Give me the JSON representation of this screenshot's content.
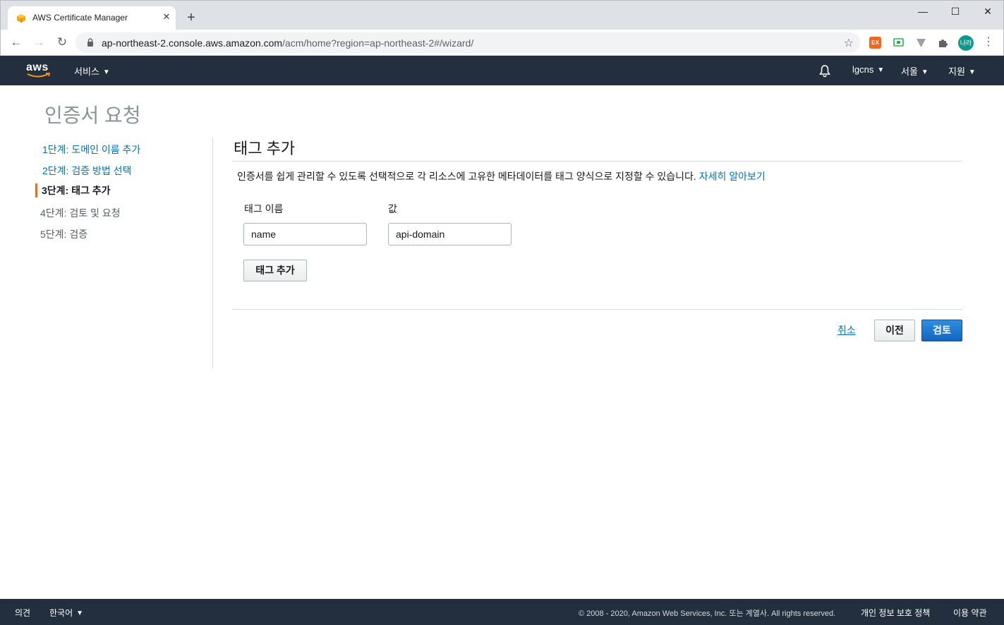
{
  "browser": {
    "tab_title": "AWS Certificate Manager",
    "tab_close": "✕",
    "new_tab": "+",
    "url_host": "ap-northeast-2.console.aws.amazon.com",
    "url_path": "/acm/home?region=ap-northeast-2#/wizard/",
    "back": "←",
    "forward": "→",
    "reload": "↻",
    "star": "☆",
    "minimize": "—",
    "maximize": "☐",
    "close": "✕",
    "ext1_label": "EX",
    "profile_label": "나라",
    "menu": "⋮"
  },
  "aws_header": {
    "logo": "aws",
    "services": "서비스",
    "account": "lgcns",
    "region": "서울",
    "support": "지원"
  },
  "page": {
    "title": "인증서 요청"
  },
  "steps": [
    {
      "label": "1단계: 도메인 이름 추가"
    },
    {
      "label": "2단계: 검증 방법 선택"
    },
    {
      "label": "3단계: 태그 추가"
    },
    {
      "label": "4단계: 검토 및 요청"
    },
    {
      "label": "5단계: 검증"
    }
  ],
  "section": {
    "title": "태그 추가",
    "description": "인증서를 쉽게 관리할 수 있도록 선택적으로 각 리소스에 고유한 메타데이터를 태그 양식으로 지정할 수 있습니다. ",
    "learn_more": "자세히 알아보기"
  },
  "tag_form": {
    "name_label": "태그 이름",
    "value_label": "값",
    "name_value": "name",
    "value_value": "api-domain",
    "add_button": "태그 추가"
  },
  "actions": {
    "cancel": "취소",
    "previous": "이전",
    "review": "검토"
  },
  "footer": {
    "feedback": "의견",
    "language": "한국어",
    "copyright": "© 2008 - 2020, Amazon Web Services, Inc. 또는 계열사. All rights reserved.",
    "privacy": "개인 정보 보호 정책",
    "terms": "이용 약관"
  },
  "colors": {
    "aws_nav": "#232f3e",
    "link": "#0073bb",
    "primary_button": "#1366c0",
    "active_step_accent": "#ec7211"
  }
}
